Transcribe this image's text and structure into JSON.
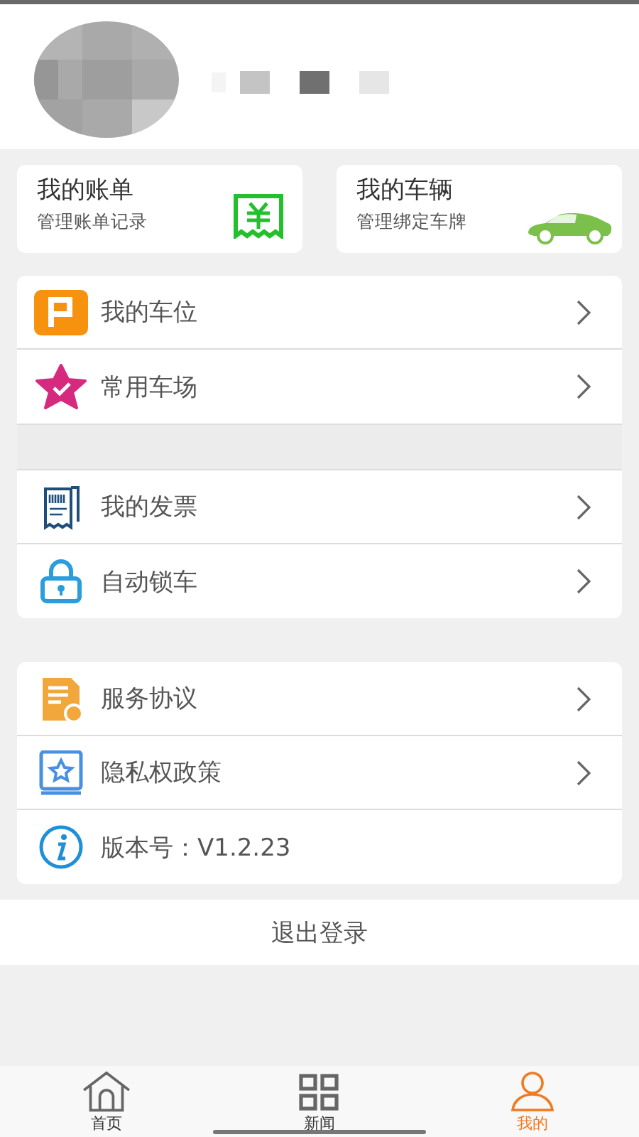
{
  "cards": [
    {
      "kind": "bill",
      "title": "我的账单",
      "subtitle": "管理账单记录"
    },
    {
      "kind": "car",
      "title": "我的车辆",
      "subtitle": "管理绑定车牌"
    }
  ],
  "menu_groups": [
    [
      {
        "kind": "parking",
        "label": "我的车位"
      },
      {
        "kind": "star",
        "label": "常用车场"
      }
    ],
    [
      {
        "kind": "invoice",
        "label": "我的发票"
      },
      {
        "kind": "lock",
        "label": "自动锁车"
      }
    ],
    [
      {
        "kind": "doc",
        "label": "服务协议"
      },
      {
        "kind": "book",
        "label": "隐私权政策"
      },
      {
        "kind": "info",
        "label": "版本号：V1.2.23"
      }
    ]
  ],
  "logout": "退出登录",
  "tabs": [
    {
      "kind": "home",
      "label": "首页",
      "selected": false
    },
    {
      "kind": "grid",
      "label": "新闻",
      "selected": false
    },
    {
      "kind": "person",
      "label": "我的",
      "selected": true
    }
  ]
}
